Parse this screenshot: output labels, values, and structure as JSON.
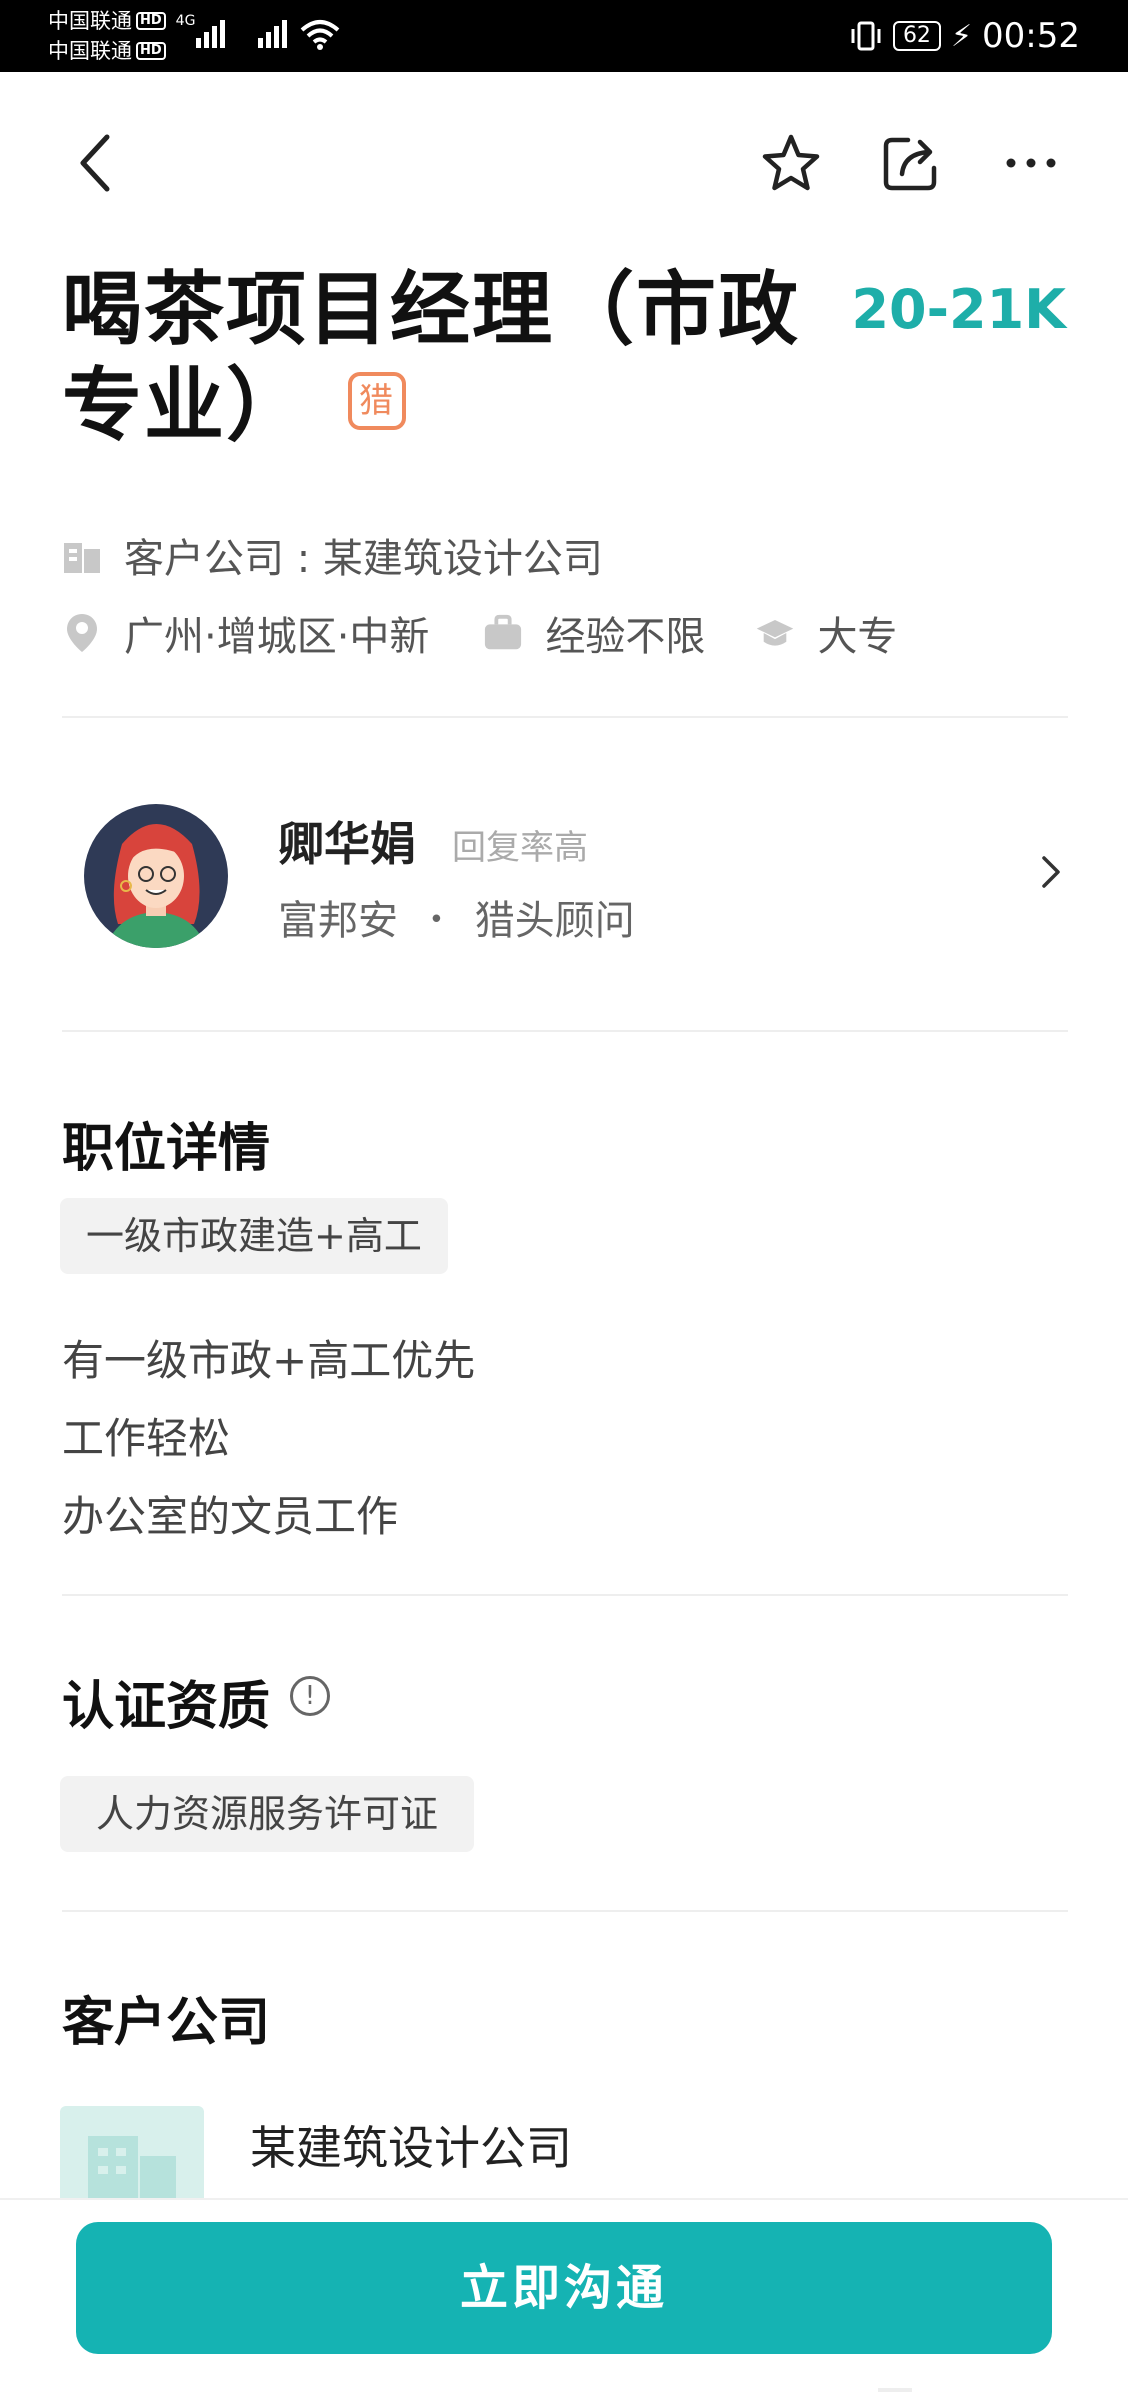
{
  "status_bar": {
    "carrier1": "中国联通",
    "carrier2": "中国联通",
    "hd": "HD",
    "network": "4G",
    "battery": "62",
    "time": "00:52"
  },
  "job": {
    "title": "喝茶项目经理（市政专业）",
    "hunter_badge": "猎",
    "salary": "20-21K",
    "company_line": "客户公司 : 某建筑设计公司",
    "location": "广州·增城区·中新",
    "experience": "经验不限",
    "education": "大专"
  },
  "recruiter": {
    "name": "卿华娟",
    "tag": "回复率高",
    "company": "富邦安",
    "dot": "•",
    "role": "猎头顾问"
  },
  "details": {
    "heading": "职位详情",
    "tag": "一级市政建造+高工",
    "lines": [
      "有一级市政+高工优先",
      "工作轻松",
      "办公室的文员工作"
    ]
  },
  "certification": {
    "heading": "认证资质",
    "info_glyph": "!",
    "chip": "人力资源服务许可证"
  },
  "client_company": {
    "heading": "客户公司",
    "name": "某建筑设计公司"
  },
  "cta": {
    "label": "立即沟通"
  },
  "colors": {
    "accent": "#15b3b3",
    "salary": "#1eaea9",
    "hunter_badge": "#f08a5d"
  },
  "icons": [
    "back-arrow-icon",
    "star-icon",
    "share-icon",
    "more-icon",
    "building-icon",
    "location-pin-icon",
    "briefcase-icon",
    "graduation-cap-icon",
    "chevron-right-icon",
    "info-icon"
  ]
}
